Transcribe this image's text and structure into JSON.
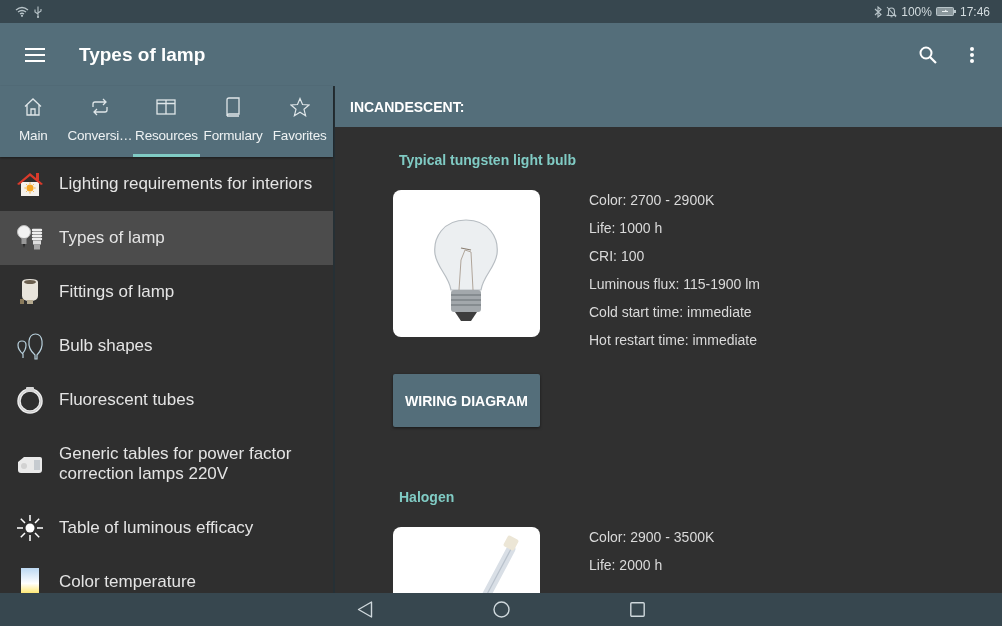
{
  "status_bar": {
    "battery_text": "100%",
    "time": "17:46"
  },
  "app_bar": {
    "title": "Types of lamp"
  },
  "tabs": [
    {
      "label": "Main",
      "selected": false
    },
    {
      "label": "Conversi…",
      "selected": false
    },
    {
      "label": "Resources",
      "selected": true
    },
    {
      "label": "Formulary",
      "selected": false
    },
    {
      "label": "Favorites",
      "selected": false
    }
  ],
  "sidebar": {
    "items": [
      {
        "label": "Lighting requirements for interiors",
        "selected": false
      },
      {
        "label": "Types of lamp",
        "selected": true
      },
      {
        "label": "Fittings of lamp",
        "selected": false
      },
      {
        "label": "Bulb shapes",
        "selected": false
      },
      {
        "label": "Fluorescent tubes",
        "selected": false
      },
      {
        "label": "Generic tables for power factor correction lamps 220V",
        "selected": false
      },
      {
        "label": "Table of luminous efficacy",
        "selected": false
      },
      {
        "label": "Color temperature",
        "selected": false
      }
    ]
  },
  "content": {
    "header": "INCANDESCENT:",
    "lamps": [
      {
        "title": "Typical tungsten light bulb",
        "specs": [
          "Color: 2700 - 2900K",
          "Life: 1000 h",
          "CRI: 100",
          "Luminous flux: 115-1900 lm",
          "Cold start time: immediate",
          "Hot restart time: immediate"
        ],
        "button": "WIRING DIAGRAM"
      },
      {
        "title": "Halogen",
        "specs": [
          "Color: 2900 - 3500K",
          "Life: 2000 h"
        ]
      }
    ]
  }
}
